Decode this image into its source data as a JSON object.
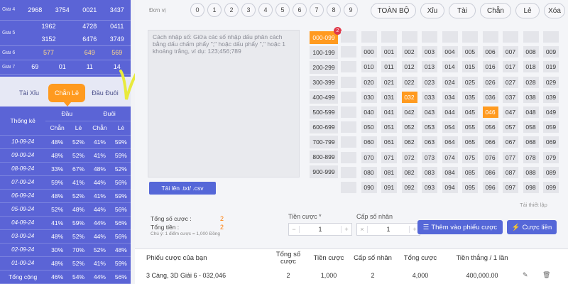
{
  "left_panel": {
    "prizes": [
      {
        "label": "Giải 4",
        "values": [
          "2968",
          "3754",
          "0021",
          "3437"
        ]
      },
      {
        "label": "Giải 5",
        "values": [
          "1962",
          "4728",
          "0411",
          "3152",
          "6476",
          "3749"
        ]
      },
      {
        "label": "Giải 6",
        "values": [
          "577",
          "649",
          "569"
        ]
      },
      {
        "label": "Giải 7",
        "values": [
          "69",
          "01",
          "11",
          "14"
        ]
      }
    ],
    "tabs": [
      "Tài Xỉu",
      "Chẵn Lẻ",
      "Đầu Đuôi"
    ],
    "stats": {
      "header_label": "Thống kê",
      "group_dau": "Đầu",
      "group_duoi": "Đuôi",
      "sub": [
        "Chẵn",
        "Lẻ",
        "Chẵn",
        "Lẻ"
      ],
      "rows": [
        {
          "date": "10-09-24",
          "v": [
            "48%",
            "52%",
            "41%",
            "59%"
          ]
        },
        {
          "date": "09-09-24",
          "v": [
            "48%",
            "52%",
            "41%",
            "59%"
          ]
        },
        {
          "date": "08-09-24",
          "v": [
            "33%",
            "67%",
            "48%",
            "52%"
          ]
        },
        {
          "date": "07-09-24",
          "v": [
            "59%",
            "41%",
            "44%",
            "56%"
          ]
        },
        {
          "date": "06-09-24",
          "v": [
            "48%",
            "52%",
            "41%",
            "59%"
          ]
        },
        {
          "date": "05-09-24",
          "v": [
            "52%",
            "48%",
            "44%",
            "56%"
          ]
        },
        {
          "date": "04-09-24",
          "v": [
            "41%",
            "59%",
            "44%",
            "56%"
          ]
        },
        {
          "date": "03-09-24",
          "v": [
            "48%",
            "52%",
            "44%",
            "56%"
          ]
        },
        {
          "date": "02-09-24",
          "v": [
            "30%",
            "70%",
            "52%",
            "48%"
          ]
        },
        {
          "date": "01-09-24",
          "v": [
            "48%",
            "52%",
            "41%",
            "59%"
          ]
        },
        {
          "date": "Tổng cộng",
          "v": [
            "46%",
            "54%",
            "44%",
            "56%"
          ]
        }
      ]
    }
  },
  "right_panel": {
    "donvi_label": "Đơn vị",
    "digits": [
      "0",
      "1",
      "2",
      "3",
      "4",
      "5",
      "6",
      "7",
      "8",
      "9"
    ],
    "filters": [
      "TOÀN BỘ",
      "Xỉu",
      "Tài",
      "Chẵn",
      "Lẻ",
      "Xóa"
    ],
    "textarea_placeholder": "Cách nhập số: Giữa các số nhập dấu phân cách bằng dấu chấm phẩy \";\" hoặc dấu phẩy \",\" hoặc 1 khoảng trắng, ví dụ: 123;456;789",
    "upload_label": "Tải lên .txt/ .csv",
    "ranges": [
      "000-099",
      "100-199",
      "200-299",
      "300-399",
      "400-499",
      "500-599",
      "600-699",
      "700-799",
      "800-899",
      "900-999"
    ],
    "active_range_badge": "2",
    "grid_rows": [
      [
        "000",
        "001",
        "002",
        "003",
        "004",
        "005",
        "006",
        "007",
        "008",
        "009"
      ],
      [
        "010",
        "011",
        "012",
        "013",
        "014",
        "015",
        "016",
        "017",
        "018",
        "019"
      ],
      [
        "020",
        "021",
        "022",
        "023",
        "024",
        "025",
        "026",
        "027",
        "028",
        "029"
      ],
      [
        "030",
        "031",
        "032",
        "033",
        "034",
        "035",
        "036",
        "037",
        "038",
        "039"
      ],
      [
        "040",
        "041",
        "042",
        "043",
        "044",
        "045",
        "046",
        "047",
        "048",
        "049"
      ],
      [
        "050",
        "051",
        "052",
        "053",
        "054",
        "055",
        "056",
        "057",
        "058",
        "059"
      ],
      [
        "060",
        "061",
        "062",
        "063",
        "064",
        "065",
        "066",
        "067",
        "068",
        "069"
      ],
      [
        "070",
        "071",
        "072",
        "073",
        "074",
        "075",
        "076",
        "077",
        "078",
        "079"
      ],
      [
        "080",
        "081",
        "082",
        "083",
        "084",
        "085",
        "086",
        "087",
        "088",
        "089"
      ],
      [
        "090",
        "091",
        "092",
        "093",
        "094",
        "095",
        "096",
        "097",
        "098",
        "099"
      ]
    ],
    "selected_numbers": [
      "032",
      "046"
    ],
    "reset_link": "Tải thiết lập",
    "summary": {
      "total_bets_label": "Tổng số cược :",
      "total_bets_value": "2",
      "total_money_label": "Tổng tiền :",
      "total_money_value": "2",
      "note": "Chú ý: 1 điểm cược = 1,000 Đồng"
    },
    "stake_label": "Tiền cược *",
    "stake_value": "1",
    "multiplier_label": "Cấp số nhân",
    "multiplier_value": "1",
    "add_button": "Thêm vào phiếu cược",
    "bet_button": "Cược liền",
    "slip": {
      "title": "Phiếu cược của bạn",
      "headers": [
        "Tổng số\ncược",
        "Tiền cược",
        "Cấp số nhân",
        "Tổng cược",
        "Tiền thắng / 1 lần"
      ],
      "row": {
        "name": "3 Càng, 3D Giải 6 - 032,046",
        "bets": "2",
        "stake": "1,000",
        "mult": "2",
        "total": "4,000",
        "win": "400,000.00"
      }
    }
  },
  "colors": {
    "sidebar": "#5b64d6",
    "accent": "#ff9a1f",
    "primary_button": "#5567d8",
    "badge": "#e03a4a"
  }
}
